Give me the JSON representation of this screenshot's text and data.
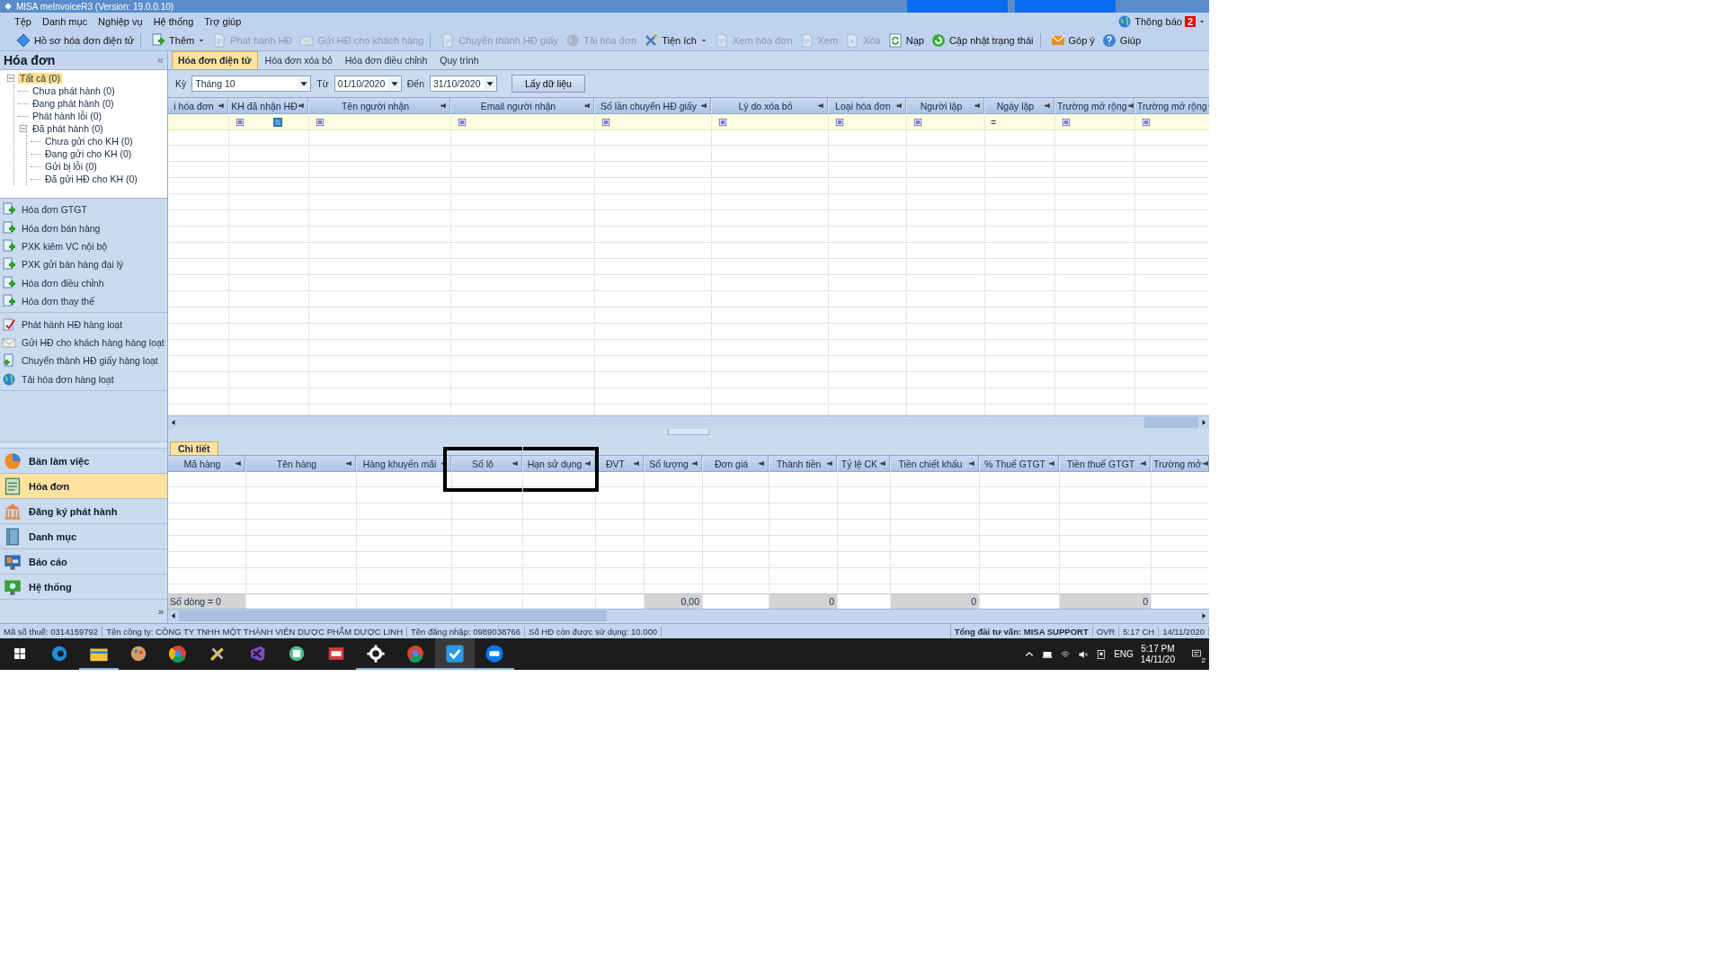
{
  "window": {
    "title": "MISA meInvoiceR3 (Version: 19.0.0.10)"
  },
  "menu": [
    "Tệp",
    "Danh mục",
    "Nghiệp vụ",
    "Hệ thống",
    "Trợ giúp"
  ],
  "notifications": {
    "label": "Thông báo",
    "count": "2"
  },
  "toolbar": [
    {
      "label": "Hồ sơ hóa đơn điện tử",
      "disabled": false,
      "dropdown": false,
      "separator_after": true
    },
    {
      "label": "Thêm",
      "disabled": false,
      "dropdown": true,
      "separator_after": false
    },
    {
      "label": "Phát hành HĐ",
      "disabled": true,
      "dropdown": false,
      "separator_after": false
    },
    {
      "label": "Gửi HĐ cho khách hàng",
      "disabled": true,
      "dropdown": false,
      "separator_after": true
    },
    {
      "label": "Chuyển thành HĐ giấy",
      "disabled": true,
      "dropdown": false,
      "separator_after": false
    },
    {
      "label": "Tải hóa đơn",
      "disabled": true,
      "dropdown": false,
      "separator_after": false
    },
    {
      "label": "Tiện ích",
      "disabled": false,
      "dropdown": true,
      "separator_after": false
    },
    {
      "label": "Xem hóa đơn",
      "disabled": true,
      "dropdown": false,
      "separator_after": false
    },
    {
      "label": "Xem",
      "disabled": true,
      "dropdown": false,
      "separator_after": false
    },
    {
      "label": "Xóa",
      "disabled": true,
      "dropdown": false,
      "separator_after": false
    },
    {
      "label": "Nạp",
      "disabled": false,
      "dropdown": false,
      "separator_after": false
    },
    {
      "label": "Cập nhật trạng thái",
      "disabled": false,
      "dropdown": false,
      "separator_after": true
    },
    {
      "label": "Góp ý",
      "disabled": false,
      "dropdown": false,
      "separator_after": false
    },
    {
      "label": "Giúp",
      "disabled": false,
      "dropdown": false,
      "separator_after": false
    }
  ],
  "sidebar": {
    "title": "Hóa đơn",
    "collapse": "«",
    "tree": [
      {
        "label": "Tất cả (0)",
        "selected": true,
        "expanded": true,
        "children": [
          {
            "label": "Chưa phát hành (0)",
            "selected": false
          },
          {
            "label": "Đang phát hành (0)",
            "selected": false
          },
          {
            "label": "Phát hành lỗi (0)",
            "selected": false
          },
          {
            "label": "Đã phát hành (0)",
            "selected": false,
            "expanded": true,
            "children": [
              {
                "label": "Chưa gửi cho KH (0)",
                "selected": false
              },
              {
                "label": "Đang gửi cho KH (0)",
                "selected": false
              },
              {
                "label": "Gửi bị lỗi (0)",
                "selected": false
              },
              {
                "label": "Đã gửi HĐ cho KH (0)",
                "selected": false
              }
            ]
          }
        ]
      }
    ],
    "action_groups": [
      [
        "Hóa đơn GTGT",
        "Hóa đơn bán hàng",
        "PXK kiêm VC nội bộ",
        "PXK gửi bán hàng đại lý",
        "Hóa đơn điều chỉnh",
        "Hóa đơn thay thế"
      ],
      [
        "Phát hành HĐ hàng loạt",
        "Gửi HĐ cho khách hàng hàng loạt",
        "Chuyển thành HĐ giấy hàng loạt",
        "Tải hóa đơn hàng loạt"
      ]
    ],
    "nav": [
      {
        "label": "Bàn làm việc",
        "selected": false
      },
      {
        "label": "Hóa đơn",
        "selected": true
      },
      {
        "label": "Đăng ký phát hành",
        "selected": false
      },
      {
        "label": "Danh mục",
        "selected": false
      },
      {
        "label": "Báo cáo",
        "selected": false
      },
      {
        "label": "Hệ thống",
        "selected": false
      }
    ],
    "more": "»"
  },
  "tabs": [
    {
      "label": "Hóa đơn điện tử",
      "selected": true
    },
    {
      "label": "Hóa đơn xóa bỏ",
      "selected": false
    },
    {
      "label": "Hóa đơn điều chỉnh",
      "selected": false
    },
    {
      "label": "Quy trình",
      "selected": false
    }
  ],
  "filter": {
    "period_label": "Kỳ",
    "period": "Tháng 10",
    "from_label": "Từ",
    "from": "01/10/2020",
    "to_label": "Đến",
    "to": "31/10/2020",
    "button": "Lấy dữ liệu"
  },
  "invoice_table": {
    "columns": [
      {
        "header": "i hóa đơn",
        "kind": "none",
        "value_checkbox": false
      },
      {
        "header": "KH đã nhận HĐ",
        "kind": "box",
        "value_checkbox": true
      },
      {
        "header": "Tên người nhận",
        "kind": "box",
        "value_checkbox": false
      },
      {
        "header": "Email người nhận",
        "kind": "box",
        "value_checkbox": false
      },
      {
        "header": "Số lần chuyển HĐ giấy",
        "kind": "box",
        "value_checkbox": false
      },
      {
        "header": "Lý do xóa bỏ",
        "kind": "box",
        "value_checkbox": false
      },
      {
        "header": "Loại hóa đơn",
        "kind": "box",
        "value_checkbox": false
      },
      {
        "header": "Người lập",
        "kind": "box",
        "value_checkbox": false
      },
      {
        "header": "Ngày lập",
        "kind": "text",
        "filter_text": "=",
        "value_checkbox": false
      },
      {
        "header": "Trường mở rộng",
        "kind": "box",
        "value_checkbox": false
      },
      {
        "header": "Trường mở rộng",
        "kind": "box",
        "value_checkbox": false
      }
    ]
  },
  "detail": {
    "tab": {
      "label": "Chi tiết",
      "selected": true
    },
    "columns": [
      {
        "header": "Mã hàng",
        "footer": "Số dòng = 0",
        "summed": true,
        "framed": false
      },
      {
        "header": "Tên hàng",
        "summed": false,
        "framed": false
      },
      {
        "header": "Hàng khuyến mãi",
        "summed": false,
        "framed": false
      },
      {
        "header": "Số lô",
        "summed": false,
        "framed": true
      },
      {
        "header": "Hạn sử dụng",
        "summed": false,
        "framed": true
      },
      {
        "header": "ĐVT",
        "summed": false,
        "framed": false
      },
      {
        "header": "Số lượng",
        "footer": "0,00",
        "summed": true,
        "framed": false
      },
      {
        "header": "Đơn giá",
        "summed": false,
        "framed": false
      },
      {
        "header": "Thành tiền",
        "footer": "0",
        "summed": true,
        "framed": false
      },
      {
        "header": "Tỷ lệ CK",
        "summed": false,
        "framed": false
      },
      {
        "header": "Tiền chiết khấu",
        "footer": "0",
        "summed": true,
        "framed": false
      },
      {
        "header": "% Thuế GTGT",
        "summed": false,
        "framed": false
      },
      {
        "header": "Tiền thuế GTGT",
        "footer": "0",
        "summed": true,
        "framed": false
      },
      {
        "header": "Trường mở",
        "summed": false,
        "framed": false
      }
    ]
  },
  "status_bar": {
    "left": [
      {
        "text": "Mã số thuế: 0314159792"
      },
      {
        "text": "Tên công ty: CÔNG TY TNHH MỘT THÀNH VIÊN DƯỢC PHẨM DƯỢC LINH"
      },
      {
        "text": "Tên đăng nhập: 0989038766"
      },
      {
        "text": "Số HĐ còn được sử dụng: 10.000"
      }
    ],
    "right": [
      {
        "text": "Tổng đài tư vấn: MISA SUPPORT",
        "bold": true
      },
      {
        "text": "OVR",
        "bold": false
      },
      {
        "text": "5:17 CH",
        "bold": false
      },
      {
        "text": "14/11/2020",
        "bold": false
      }
    ]
  },
  "taskbar": {
    "apps": [
      {
        "running": false,
        "selected": false
      },
      {
        "running": true,
        "selected": false
      },
      {
        "running": false,
        "selected": false
      },
      {
        "running": false,
        "selected": false
      },
      {
        "running": false,
        "selected": false
      },
      {
        "running": false,
        "selected": false
      },
      {
        "running": false,
        "selected": false
      },
      {
        "running": false,
        "selected": false
      },
      {
        "running": true,
        "selected": false
      },
      {
        "running": true,
        "selected": false
      },
      {
        "running": true,
        "selected": true
      },
      {
        "running": true,
        "selected": false
      }
    ],
    "language": "ENG",
    "time": "5:17 PM",
    "date": "14/11/20",
    "notification_count": "2"
  }
}
